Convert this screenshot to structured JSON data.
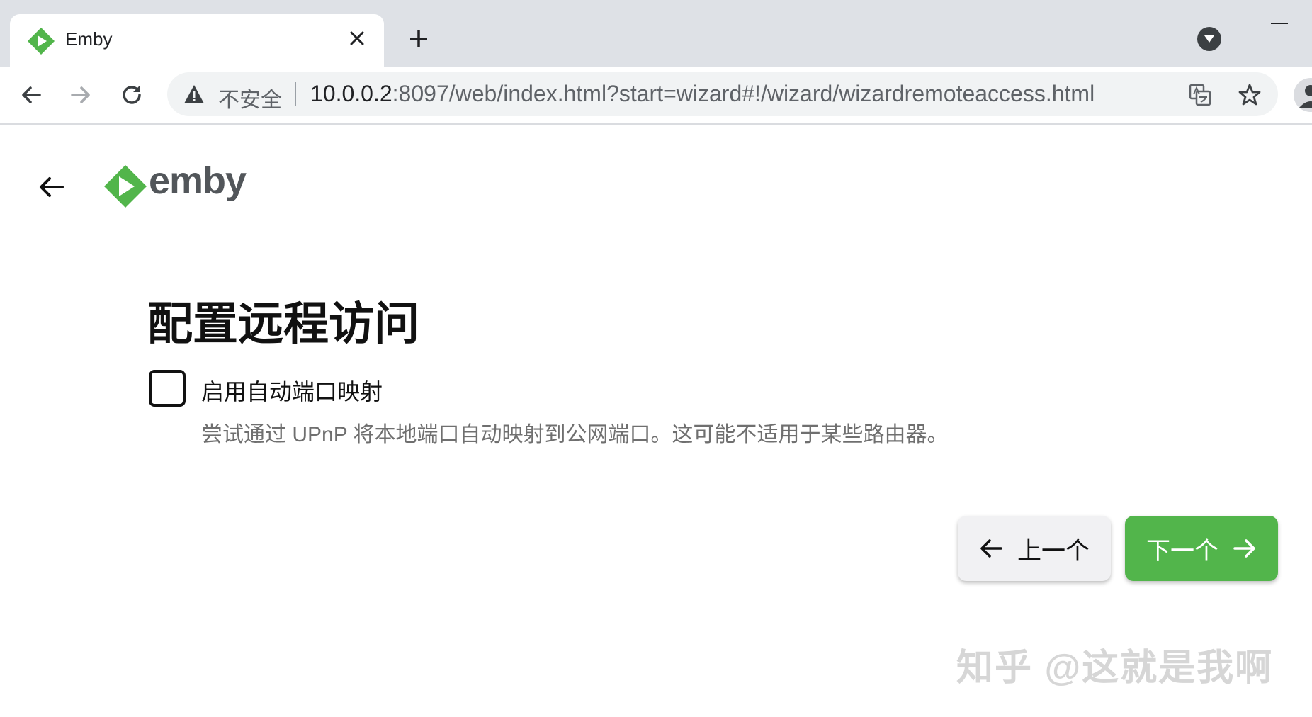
{
  "browser": {
    "tab_title": "Emby",
    "security_label": "不安全",
    "url_host": "10.0.0.2",
    "url_rest": ":8097/web/index.html?start=wizard#!/wizard/wizardremoteaccess.html"
  },
  "app": {
    "logo_text": "emby",
    "brand_color": "#52b54b"
  },
  "wizard": {
    "title": "配置远程访问",
    "checkbox_label": "启用自动端口映射",
    "checkbox_checked": false,
    "checkbox_description": "尝试通过 UPnP 将本地端口自动映射到公网端口。这可能不适用于某些路由器。",
    "prev_label": "上一个",
    "next_label": "下一个"
  },
  "watermark": "知乎 @这就是我啊",
  "icons": [
    "emby-logo-icon",
    "close-icon",
    "plus-icon",
    "chevron-down-icon",
    "arrow-left-icon",
    "arrow-right-icon",
    "reload-icon",
    "warning-icon",
    "translate-icon",
    "star-icon",
    "profile-icon"
  ]
}
